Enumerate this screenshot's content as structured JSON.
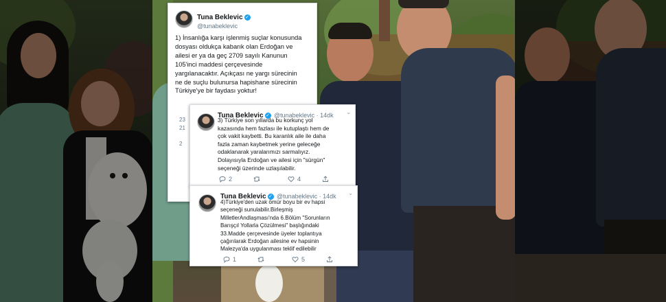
{
  "tweets": [
    {
      "name": "Tuna Beklevic",
      "handle": "@tunabeklevic",
      "body": "1) İnsanlığa karşı işlenmiş suçlar konusunda\ndosyası oldukça kabarık olan Erdoğan ve\nailesi er ya da geç 2709 sayılı Kanunun\n105'inci maddesi çerçevesinde\nyargılanacaktır. Açıkçası ne yargı sürecinin\nne de suçlu bulunursa hapishane sürecinin\nTürkiye'ye bir faydası yoktur!"
    },
    {
      "name": "Tuna Beklevic",
      "handle": "@tunabeklevic · 14dk",
      "body": "3) Türkiye son yıllarda bu korkunç yol\nkazasında hem fazlası ile kutuplaştı hem de\nçok vakit kaybetti. Bu karanlık aile ile daha\nfazla zaman kaybetmek yerine geleceğe\nodaklanarak yaralarımızı sarmalıyız.\nDolayısıyla Erdoğan ve ailesi için \"sürgün\"\nseçeneği üzerinde uzlaşılabilir.",
      "replies": "2",
      "likes": "4"
    },
    {
      "name": "Tuna Beklevic",
      "handle": "@tunabeklevic · 14dk",
      "body": "4)Türkiye'den uzak ömür boyu bir ev hapsi\nseçeneği sunulabilir.Birleşmiş\nMilletlerAndlaşması'nda 6.Bölüm \"Sorunların\nBarışçıl Yollarla Çözülmesi\" başlığındaki\n33.Madde çerçevesinde üyeler toplantıya\nçağırılarak Erdoğan ailesine ev hapsinin\nMalezya'da uygulanması teklif edilebilir",
      "replies": "1",
      "likes": "5"
    }
  ],
  "side_numbers": [
    "23",
    "21",
    "2"
  ],
  "colors": {
    "verified": "#1da1f2",
    "secondary_text": "#657786"
  }
}
